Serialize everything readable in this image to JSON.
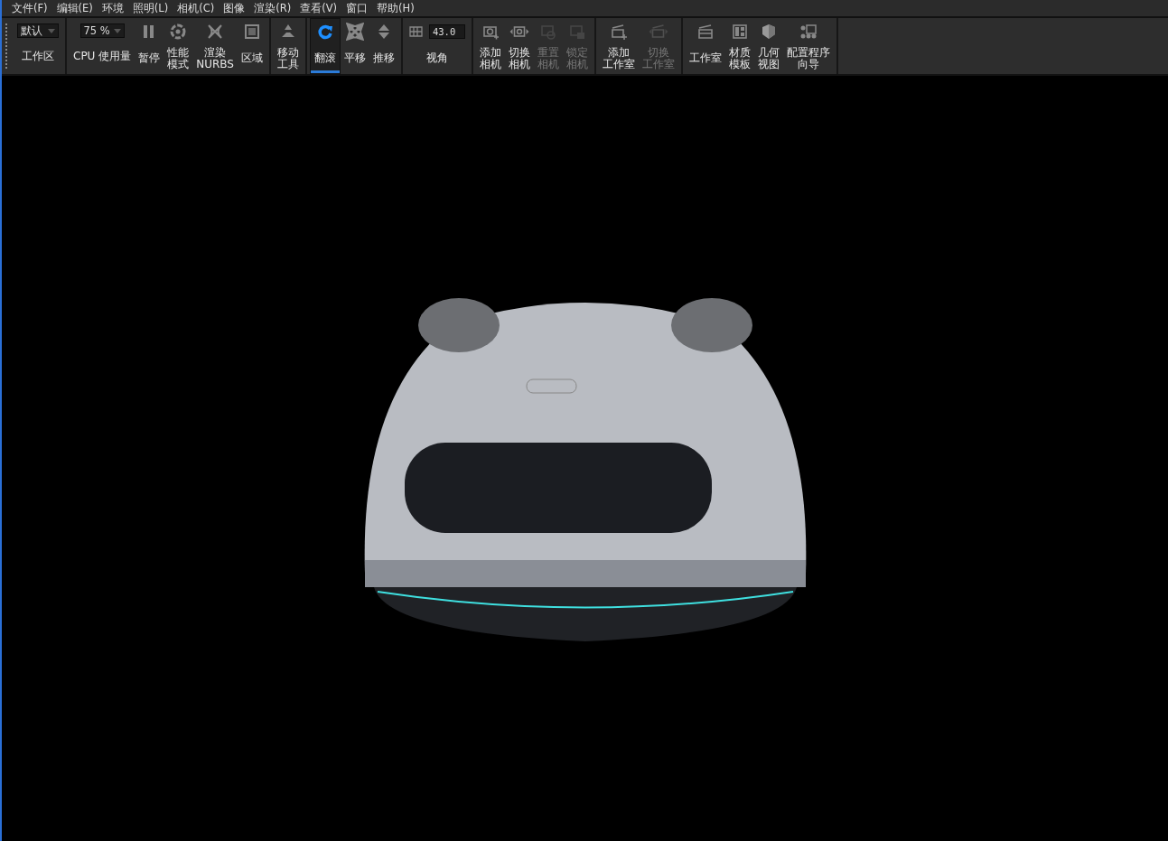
{
  "menu": [
    {
      "label": "文件(F)"
    },
    {
      "label": "编辑(E)"
    },
    {
      "label": "环境"
    },
    {
      "label": "照明(L)"
    },
    {
      "label": "相机(C)"
    },
    {
      "label": "图像"
    },
    {
      "label": "渲染(R)"
    },
    {
      "label": "查看(V)"
    },
    {
      "label": "窗口"
    },
    {
      "label": "帮助(H)"
    }
  ],
  "toolbar": [
    {
      "items": [
        {
          "kind": "dropdown",
          "value": "默认",
          "label": "工作区"
        }
      ]
    },
    {
      "items": [
        {
          "kind": "dropdown",
          "value": "75 %",
          "label": "CPU 使用量"
        },
        {
          "kind": "button",
          "lines": [
            "暂停"
          ],
          "selected": false,
          "disabled": false
        },
        {
          "kind": "button",
          "lines": [
            "性能",
            "模式"
          ],
          "selected": false,
          "disabled": false
        },
        {
          "kind": "button",
          "lines": [
            "渲染",
            "NURBS"
          ],
          "selected": false,
          "disabled": false
        },
        {
          "kind": "button",
          "lines": [
            "区域"
          ],
          "selected": false,
          "disabled": false
        }
      ]
    },
    {
      "items": [
        {
          "kind": "button",
          "lines": [
            "移动",
            "工具"
          ],
          "selected": false,
          "disabled": false
        }
      ]
    },
    {
      "items": [
        {
          "kind": "button",
          "lines": [
            "翻滚"
          ],
          "selected": true,
          "disabled": false
        },
        {
          "kind": "button",
          "lines": [
            "平移"
          ],
          "selected": false,
          "disabled": false
        },
        {
          "kind": "button",
          "lines": [
            "推移"
          ],
          "selected": false,
          "disabled": false
        }
      ]
    },
    {
      "items": [
        {
          "kind": "field",
          "value": "43.0",
          "label": "视角"
        }
      ]
    },
    {
      "items": [
        {
          "kind": "button",
          "lines": [
            "添加",
            "相机"
          ],
          "selected": false,
          "disabled": false
        },
        {
          "kind": "button",
          "lines": [
            "切换",
            "相机"
          ],
          "selected": false,
          "disabled": false
        },
        {
          "kind": "button",
          "lines": [
            "重置",
            "相机"
          ],
          "selected": false,
          "disabled": true
        },
        {
          "kind": "button",
          "lines": [
            "锁定",
            "相机"
          ],
          "selected": false,
          "disabled": true
        }
      ]
    },
    {
      "items": [
        {
          "kind": "button",
          "lines": [
            "添加",
            "工作室"
          ],
          "selected": false,
          "disabled": false
        },
        {
          "kind": "button",
          "lines": [
            "切换",
            "工作室"
          ],
          "selected": false,
          "disabled": true
        }
      ]
    },
    {
      "items": [
        {
          "kind": "button",
          "lines": [
            "工作室"
          ],
          "selected": false,
          "disabled": false
        },
        {
          "kind": "button",
          "lines": [
            "材质",
            "模板"
          ],
          "selected": false,
          "disabled": false
        },
        {
          "kind": "button",
          "lines": [
            "几何",
            "视图"
          ],
          "selected": false,
          "disabled": false
        },
        {
          "kind": "button",
          "lines": [
            "配置程序",
            "向导"
          ],
          "selected": false,
          "disabled": false
        }
      ]
    }
  ]
}
